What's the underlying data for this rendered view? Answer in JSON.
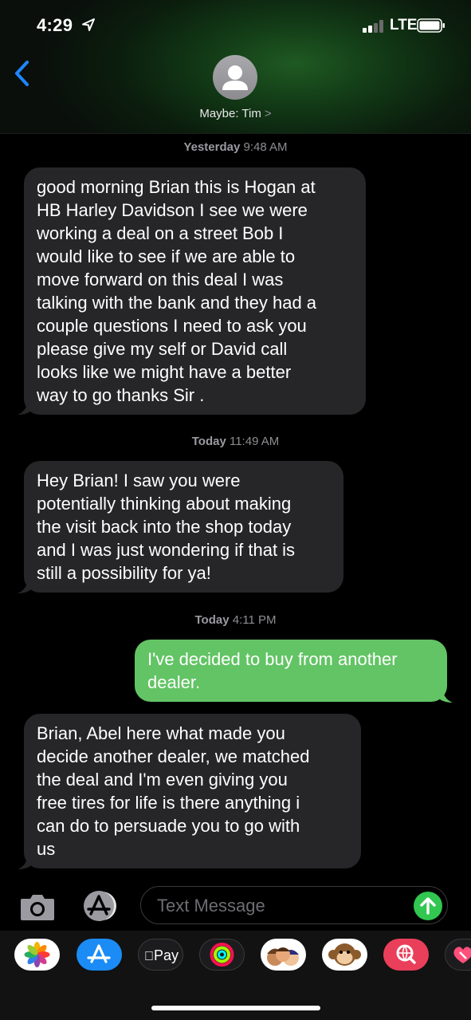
{
  "status_bar": {
    "time": "4:29",
    "network": "LTE"
  },
  "header": {
    "contact_name": "Maybe: Tim",
    "contact_chevron": ">"
  },
  "messages": [
    {
      "timestamp_day": "Yesterday",
      "timestamp_time": "9:48 AM"
    },
    {
      "lines": [
        "good morning Brian this is Hogan at",
        "HB Harley Davidson I see we were",
        "working a deal on a street Bob I",
        "would like to see if we are able to",
        "move forward on this deal I was",
        "talking with the bank and they had a",
        "couple questions I need to ask you",
        "please give my self or David call",
        "looks like we might have a better",
        "way to go thanks Sir ."
      ]
    },
    {
      "timestamp_day": "Today",
      "timestamp_time": "11:49 AM"
    },
    {
      "lines": [
        "Hey Brian! I saw you were",
        "potentially thinking about making",
        "the visit back into the shop today",
        "and I was just wondering if that is",
        "still a possibility for ya!"
      ]
    },
    {
      "timestamp_day": "Today",
      "timestamp_time": "4:11 PM"
    },
    {
      "lines": [
        "I've decided to buy from another",
        "dealer."
      ]
    },
    {
      "lines": [
        "Brian, Abel here what made you",
        "decide another dealer, we matched",
        "the deal and I'm even giving you",
        "free tires for life is there anything i",
        "can do to persuade you to go with",
        "us"
      ]
    }
  ],
  "composer": {
    "placeholder": "Text Message"
  },
  "app_strip": {
    "apps": [
      {
        "name": "photos",
        "label": ""
      },
      {
        "name": "app-store",
        "label": ""
      },
      {
        "name": "apple-pay",
        "label": "Pay"
      },
      {
        "name": "activity",
        "label": ""
      },
      {
        "name": "memoji",
        "label": ""
      },
      {
        "name": "animoji-monkey",
        "label": ""
      },
      {
        "name": "web-search",
        "label": ""
      },
      {
        "name": "digital-touch",
        "label": ""
      }
    ]
  },
  "colors": {
    "incoming": "#262628",
    "outgoing": "#62c464",
    "accent_blue": "#1f86ff",
    "send_green": "#31c750"
  }
}
